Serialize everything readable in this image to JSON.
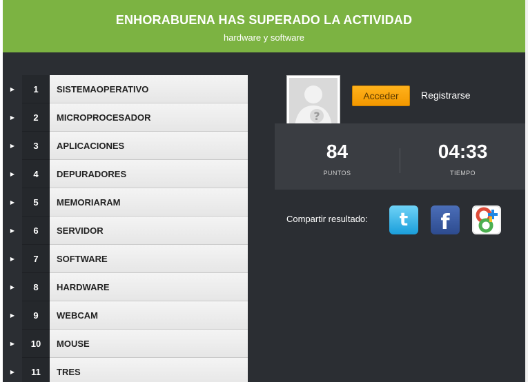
{
  "header": {
    "title": "ENHORABUENA HAS SUPERADO LA ACTIVIDAD",
    "subtitle": "hardware y software"
  },
  "list": [
    {
      "num": "1",
      "label": "SISTEMAOPERATIVO"
    },
    {
      "num": "2",
      "label": "MICROPROCESADOR"
    },
    {
      "num": "3",
      "label": "APLICACIONES"
    },
    {
      "num": "4",
      "label": "DEPURADORES"
    },
    {
      "num": "5",
      "label": "MEMORIARAM"
    },
    {
      "num": "6",
      "label": "SERVIDOR"
    },
    {
      "num": "7",
      "label": "SOFTWARE"
    },
    {
      "num": "8",
      "label": "HARDWARE"
    },
    {
      "num": "9",
      "label": "WEBCAM"
    },
    {
      "num": "10",
      "label": "MOUSE"
    },
    {
      "num": "11",
      "label": "TRES"
    }
  ],
  "auth": {
    "login_label": "Acceder",
    "register_label": "Registrarse"
  },
  "stats": {
    "points_value": "84",
    "points_caption": "PUNTOS",
    "time_value": "04:33",
    "time_caption": "TIEMPO"
  },
  "share": {
    "label": "Compartir resultado:",
    "icons": [
      "twitter-icon",
      "facebook-icon",
      "google-icon"
    ]
  },
  "colors": {
    "header_green": "#7cb342",
    "panel_dark": "#2b2e33",
    "button_orange": "#f39800"
  }
}
